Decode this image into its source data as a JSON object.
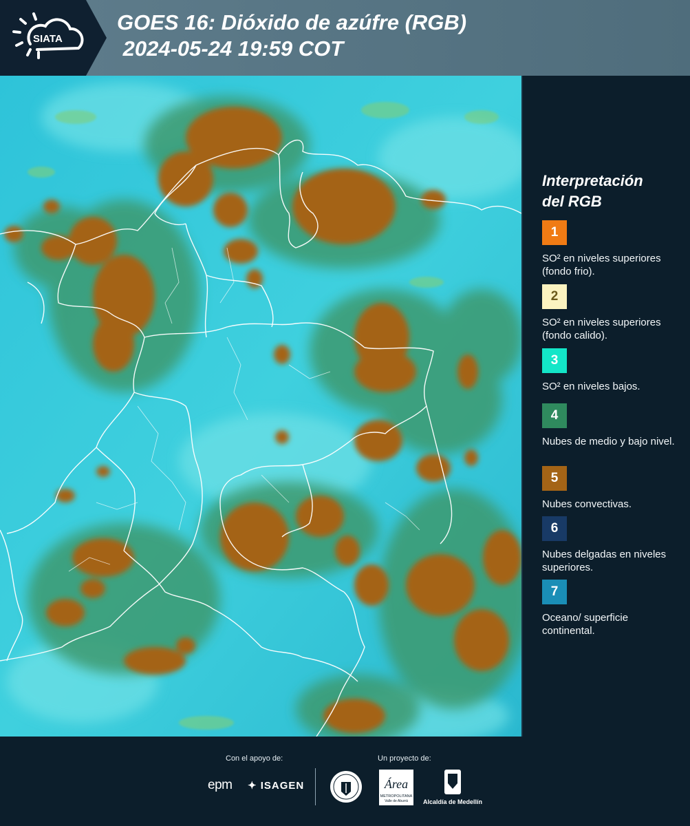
{
  "header": {
    "logo_text": "SIATA",
    "title_line1": "GOES 16: Dióxido de azúfre (RGB)",
    "title_line2": " 2024-05-24 19:59 COT"
  },
  "legend": {
    "title_line1": "Interpretación",
    "title_line2": "del RGB",
    "items": [
      {
        "number": "1",
        "color": "#f07b14",
        "text": "SO² en niveles superiores (fondo frio)."
      },
      {
        "number": "2",
        "color": "#fbf3c0",
        "text": "SO² en niveles superiores (fondo calido)."
      },
      {
        "number": "3",
        "color": "#13e6c8",
        "text": "SO² en niveles bajos."
      },
      {
        "number": "4",
        "color": "#2f8a5e",
        "text": "Nubes de medio y bajo nivel."
      },
      {
        "number": "5",
        "color": "#a46416",
        "text": "Nubes convectivas."
      },
      {
        "number": "6",
        "color": "#183a66",
        "text": "Nubes delgadas en niveles superiores."
      },
      {
        "number": "7",
        "color": "#1a8eb6",
        "text": "Oceano/ superficie continental."
      }
    ]
  },
  "footer": {
    "support_label": "Con el apoyo de:",
    "project_label": "Un proyecto de:",
    "sponsors": [
      "epm",
      "ISAGEN"
    ],
    "area_logo_text": "Área",
    "area_logo_sub": "METROPOLITANA",
    "area_logo_sub2": "Valle de Aburrá",
    "alcaldia_text": "Alcaldía de Medellín"
  },
  "colors": {
    "header_bg": "#0f2030",
    "header_band": "#5d7b8a",
    "map_background": "#33c6d8",
    "cloud_convective": "#a46416",
    "cloud_mid": "#2f8a5e",
    "borders": "#ffffff"
  }
}
